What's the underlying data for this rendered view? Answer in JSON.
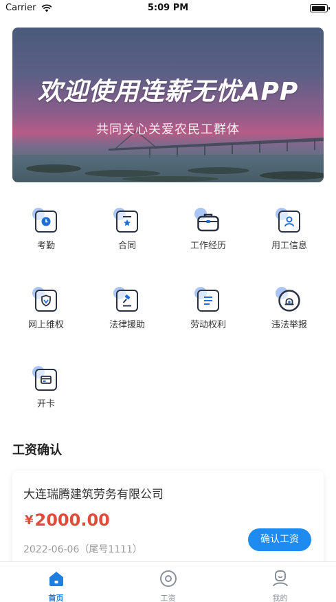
{
  "status_bar": {
    "carrier": "Carrier",
    "time": "5:09 PM"
  },
  "banner": {
    "title": "欢迎使用连薪无忧APP",
    "subtitle": "共同关心关爱农民工群体"
  },
  "functions": [
    {
      "label": "考勤",
      "icon": "clock-icon"
    },
    {
      "label": "合同",
      "icon": "contract-icon"
    },
    {
      "label": "工作经历",
      "icon": "briefcase-icon"
    },
    {
      "label": "用工信息",
      "icon": "user-card-icon"
    },
    {
      "label": "网上维权",
      "icon": "shield-icon"
    },
    {
      "label": "法律援助",
      "icon": "gavel-icon"
    },
    {
      "label": "劳动权利",
      "icon": "document-icon"
    },
    {
      "label": "违法举报",
      "icon": "alarm-icon"
    },
    {
      "label": "开卡",
      "icon": "card-icon"
    }
  ],
  "wage_section": {
    "title": "工资确认",
    "card": {
      "company": "大连瑞腾建筑劳务有限公司",
      "currency": "¥",
      "amount": "2000.00",
      "date": "2022-06-06（尾号1111）",
      "confirm_button": "确认工资"
    }
  },
  "tab_bar": {
    "items": [
      {
        "label": "首页",
        "active": true,
        "icon": "home-icon"
      },
      {
        "label": "工资",
        "active": false,
        "icon": "wage-icon"
      },
      {
        "label": "我的",
        "active": false,
        "icon": "profile-icon"
      }
    ]
  },
  "colors": {
    "accent": "#1e8bf0",
    "amount": "#e14b3b",
    "icon_blob": "#a9c6f5",
    "icon_stroke": "#2a3140"
  }
}
